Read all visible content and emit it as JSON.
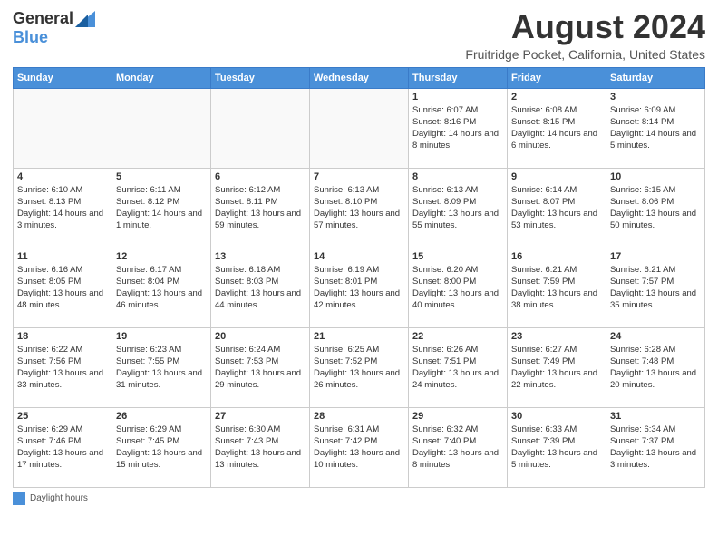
{
  "logo": {
    "general": "General",
    "blue": "Blue"
  },
  "title": {
    "month": "August 2024",
    "location": "Fruitridge Pocket, California, United States"
  },
  "days_of_week": [
    "Sunday",
    "Monday",
    "Tuesday",
    "Wednesday",
    "Thursday",
    "Friday",
    "Saturday"
  ],
  "weeks": [
    [
      {
        "day": "",
        "info": ""
      },
      {
        "day": "",
        "info": ""
      },
      {
        "day": "",
        "info": ""
      },
      {
        "day": "",
        "info": ""
      },
      {
        "day": "1",
        "info": "Sunrise: 6:07 AM\nSunset: 8:16 PM\nDaylight: 14 hours and 8 minutes."
      },
      {
        "day": "2",
        "info": "Sunrise: 6:08 AM\nSunset: 8:15 PM\nDaylight: 14 hours and 6 minutes."
      },
      {
        "day": "3",
        "info": "Sunrise: 6:09 AM\nSunset: 8:14 PM\nDaylight: 14 hours and 5 minutes."
      }
    ],
    [
      {
        "day": "4",
        "info": "Sunrise: 6:10 AM\nSunset: 8:13 PM\nDaylight: 14 hours and 3 minutes."
      },
      {
        "day": "5",
        "info": "Sunrise: 6:11 AM\nSunset: 8:12 PM\nDaylight: 14 hours and 1 minute."
      },
      {
        "day": "6",
        "info": "Sunrise: 6:12 AM\nSunset: 8:11 PM\nDaylight: 13 hours and 59 minutes."
      },
      {
        "day": "7",
        "info": "Sunrise: 6:13 AM\nSunset: 8:10 PM\nDaylight: 13 hours and 57 minutes."
      },
      {
        "day": "8",
        "info": "Sunrise: 6:13 AM\nSunset: 8:09 PM\nDaylight: 13 hours and 55 minutes."
      },
      {
        "day": "9",
        "info": "Sunrise: 6:14 AM\nSunset: 8:07 PM\nDaylight: 13 hours and 53 minutes."
      },
      {
        "day": "10",
        "info": "Sunrise: 6:15 AM\nSunset: 8:06 PM\nDaylight: 13 hours and 50 minutes."
      }
    ],
    [
      {
        "day": "11",
        "info": "Sunrise: 6:16 AM\nSunset: 8:05 PM\nDaylight: 13 hours and 48 minutes."
      },
      {
        "day": "12",
        "info": "Sunrise: 6:17 AM\nSunset: 8:04 PM\nDaylight: 13 hours and 46 minutes."
      },
      {
        "day": "13",
        "info": "Sunrise: 6:18 AM\nSunset: 8:03 PM\nDaylight: 13 hours and 44 minutes."
      },
      {
        "day": "14",
        "info": "Sunrise: 6:19 AM\nSunset: 8:01 PM\nDaylight: 13 hours and 42 minutes."
      },
      {
        "day": "15",
        "info": "Sunrise: 6:20 AM\nSunset: 8:00 PM\nDaylight: 13 hours and 40 minutes."
      },
      {
        "day": "16",
        "info": "Sunrise: 6:21 AM\nSunset: 7:59 PM\nDaylight: 13 hours and 38 minutes."
      },
      {
        "day": "17",
        "info": "Sunrise: 6:21 AM\nSunset: 7:57 PM\nDaylight: 13 hours and 35 minutes."
      }
    ],
    [
      {
        "day": "18",
        "info": "Sunrise: 6:22 AM\nSunset: 7:56 PM\nDaylight: 13 hours and 33 minutes."
      },
      {
        "day": "19",
        "info": "Sunrise: 6:23 AM\nSunset: 7:55 PM\nDaylight: 13 hours and 31 minutes."
      },
      {
        "day": "20",
        "info": "Sunrise: 6:24 AM\nSunset: 7:53 PM\nDaylight: 13 hours and 29 minutes."
      },
      {
        "day": "21",
        "info": "Sunrise: 6:25 AM\nSunset: 7:52 PM\nDaylight: 13 hours and 26 minutes."
      },
      {
        "day": "22",
        "info": "Sunrise: 6:26 AM\nSunset: 7:51 PM\nDaylight: 13 hours and 24 minutes."
      },
      {
        "day": "23",
        "info": "Sunrise: 6:27 AM\nSunset: 7:49 PM\nDaylight: 13 hours and 22 minutes."
      },
      {
        "day": "24",
        "info": "Sunrise: 6:28 AM\nSunset: 7:48 PM\nDaylight: 13 hours and 20 minutes."
      }
    ],
    [
      {
        "day": "25",
        "info": "Sunrise: 6:29 AM\nSunset: 7:46 PM\nDaylight: 13 hours and 17 minutes."
      },
      {
        "day": "26",
        "info": "Sunrise: 6:29 AM\nSunset: 7:45 PM\nDaylight: 13 hours and 15 minutes."
      },
      {
        "day": "27",
        "info": "Sunrise: 6:30 AM\nSunset: 7:43 PM\nDaylight: 13 hours and 13 minutes."
      },
      {
        "day": "28",
        "info": "Sunrise: 6:31 AM\nSunset: 7:42 PM\nDaylight: 13 hours and 10 minutes."
      },
      {
        "day": "29",
        "info": "Sunrise: 6:32 AM\nSunset: 7:40 PM\nDaylight: 13 hours and 8 minutes."
      },
      {
        "day": "30",
        "info": "Sunrise: 6:33 AM\nSunset: 7:39 PM\nDaylight: 13 hours and 5 minutes."
      },
      {
        "day": "31",
        "info": "Sunrise: 6:34 AM\nSunset: 7:37 PM\nDaylight: 13 hours and 3 minutes."
      }
    ]
  ],
  "legend": {
    "label": "Daylight hours"
  }
}
